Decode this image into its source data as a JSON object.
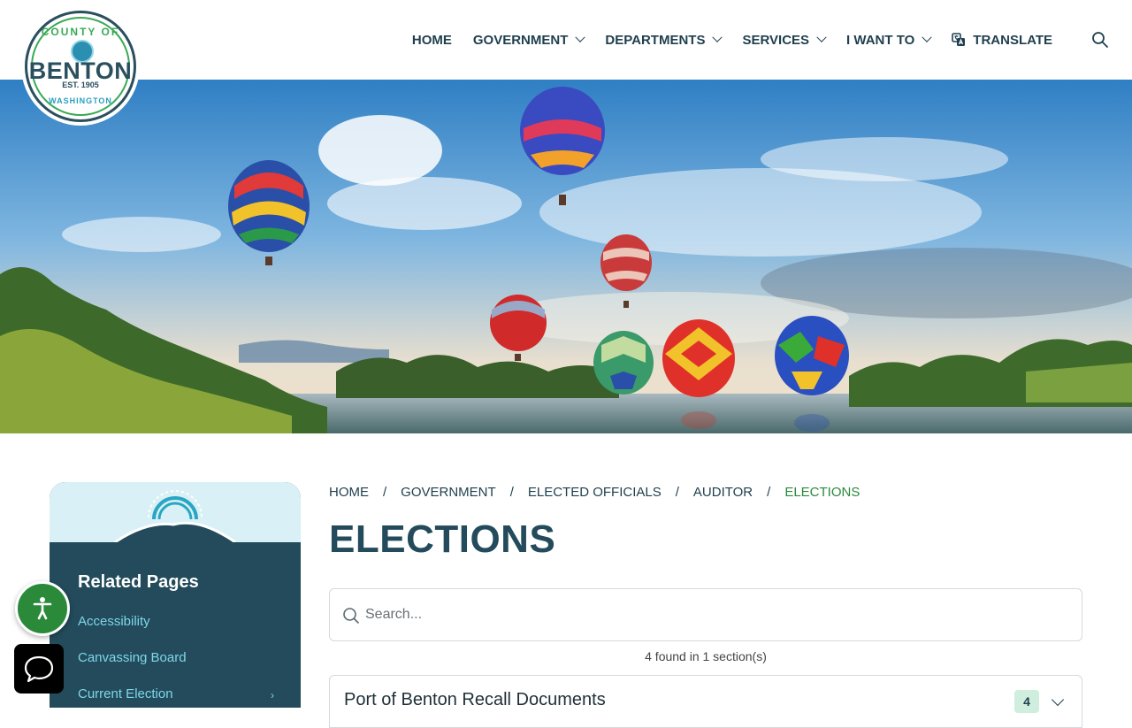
{
  "logo": {
    "top_text": "COUNTY OF",
    "name": "BENTON",
    "est": "EST. 1905",
    "state": "WASHINGTON"
  },
  "nav": {
    "items": [
      {
        "label": "HOME",
        "has_dropdown": false
      },
      {
        "label": "GOVERNMENT",
        "has_dropdown": true
      },
      {
        "label": "DEPARTMENTS",
        "has_dropdown": true
      },
      {
        "label": "SERVICES",
        "has_dropdown": true
      },
      {
        "label": "I WANT TO",
        "has_dropdown": true
      }
    ],
    "translate_label": "TRANSLATE"
  },
  "sidebar": {
    "heading": "Related Pages",
    "links": [
      {
        "label": "Accessibility"
      },
      {
        "label": "Canvassing Board"
      },
      {
        "label": "Current Election",
        "has_submenu": true
      }
    ]
  },
  "breadcrumb": [
    "HOME",
    "GOVERNMENT",
    "ELECTED OFFICIALS",
    "AUDITOR",
    "ELECTIONS"
  ],
  "page_title": "ELECTIONS",
  "search": {
    "placeholder": "Search...",
    "result_text": "4 found in 1 section(s)"
  },
  "accordion": [
    {
      "title": "Port of Benton Recall Documents",
      "count": "4"
    }
  ],
  "colors": {
    "brand_dark": "#234b5b",
    "accent_green": "#2a8a3a",
    "link_cyan": "#7ed6ea"
  }
}
